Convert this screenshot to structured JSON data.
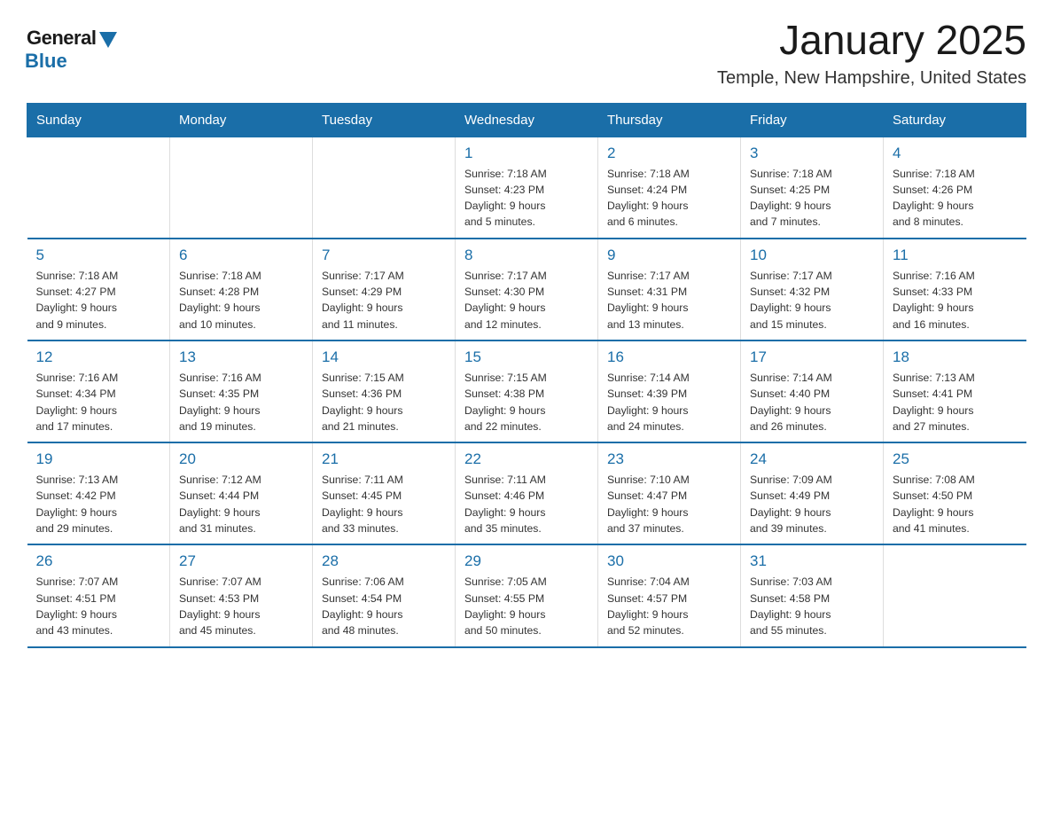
{
  "logo": {
    "text_general": "General",
    "text_blue": "Blue"
  },
  "title": "January 2025",
  "subtitle": "Temple, New Hampshire, United States",
  "days_of_week": [
    "Sunday",
    "Monday",
    "Tuesday",
    "Wednesday",
    "Thursday",
    "Friday",
    "Saturday"
  ],
  "weeks": [
    [
      {
        "day": null
      },
      {
        "day": null
      },
      {
        "day": null
      },
      {
        "day": "1",
        "sunrise": "7:18 AM",
        "sunset": "4:23 PM",
        "daylight": "9 hours and 5 minutes."
      },
      {
        "day": "2",
        "sunrise": "7:18 AM",
        "sunset": "4:24 PM",
        "daylight": "9 hours and 6 minutes."
      },
      {
        "day": "3",
        "sunrise": "7:18 AM",
        "sunset": "4:25 PM",
        "daylight": "9 hours and 7 minutes."
      },
      {
        "day": "4",
        "sunrise": "7:18 AM",
        "sunset": "4:26 PM",
        "daylight": "9 hours and 8 minutes."
      }
    ],
    [
      {
        "day": "5",
        "sunrise": "7:18 AM",
        "sunset": "4:27 PM",
        "daylight": "9 hours and 9 minutes."
      },
      {
        "day": "6",
        "sunrise": "7:18 AM",
        "sunset": "4:28 PM",
        "daylight": "9 hours and 10 minutes."
      },
      {
        "day": "7",
        "sunrise": "7:17 AM",
        "sunset": "4:29 PM",
        "daylight": "9 hours and 11 minutes."
      },
      {
        "day": "8",
        "sunrise": "7:17 AM",
        "sunset": "4:30 PM",
        "daylight": "9 hours and 12 minutes."
      },
      {
        "day": "9",
        "sunrise": "7:17 AM",
        "sunset": "4:31 PM",
        "daylight": "9 hours and 13 minutes."
      },
      {
        "day": "10",
        "sunrise": "7:17 AM",
        "sunset": "4:32 PM",
        "daylight": "9 hours and 15 minutes."
      },
      {
        "day": "11",
        "sunrise": "7:16 AM",
        "sunset": "4:33 PM",
        "daylight": "9 hours and 16 minutes."
      }
    ],
    [
      {
        "day": "12",
        "sunrise": "7:16 AM",
        "sunset": "4:34 PM",
        "daylight": "9 hours and 17 minutes."
      },
      {
        "day": "13",
        "sunrise": "7:16 AM",
        "sunset": "4:35 PM",
        "daylight": "9 hours and 19 minutes."
      },
      {
        "day": "14",
        "sunrise": "7:15 AM",
        "sunset": "4:36 PM",
        "daylight": "9 hours and 21 minutes."
      },
      {
        "day": "15",
        "sunrise": "7:15 AM",
        "sunset": "4:38 PM",
        "daylight": "9 hours and 22 minutes."
      },
      {
        "day": "16",
        "sunrise": "7:14 AM",
        "sunset": "4:39 PM",
        "daylight": "9 hours and 24 minutes."
      },
      {
        "day": "17",
        "sunrise": "7:14 AM",
        "sunset": "4:40 PM",
        "daylight": "9 hours and 26 minutes."
      },
      {
        "day": "18",
        "sunrise": "7:13 AM",
        "sunset": "4:41 PM",
        "daylight": "9 hours and 27 minutes."
      }
    ],
    [
      {
        "day": "19",
        "sunrise": "7:13 AM",
        "sunset": "4:42 PM",
        "daylight": "9 hours and 29 minutes."
      },
      {
        "day": "20",
        "sunrise": "7:12 AM",
        "sunset": "4:44 PM",
        "daylight": "9 hours and 31 minutes."
      },
      {
        "day": "21",
        "sunrise": "7:11 AM",
        "sunset": "4:45 PM",
        "daylight": "9 hours and 33 minutes."
      },
      {
        "day": "22",
        "sunrise": "7:11 AM",
        "sunset": "4:46 PM",
        "daylight": "9 hours and 35 minutes."
      },
      {
        "day": "23",
        "sunrise": "7:10 AM",
        "sunset": "4:47 PM",
        "daylight": "9 hours and 37 minutes."
      },
      {
        "day": "24",
        "sunrise": "7:09 AM",
        "sunset": "4:49 PM",
        "daylight": "9 hours and 39 minutes."
      },
      {
        "day": "25",
        "sunrise": "7:08 AM",
        "sunset": "4:50 PM",
        "daylight": "9 hours and 41 minutes."
      }
    ],
    [
      {
        "day": "26",
        "sunrise": "7:07 AM",
        "sunset": "4:51 PM",
        "daylight": "9 hours and 43 minutes."
      },
      {
        "day": "27",
        "sunrise": "7:07 AM",
        "sunset": "4:53 PM",
        "daylight": "9 hours and 45 minutes."
      },
      {
        "day": "28",
        "sunrise": "7:06 AM",
        "sunset": "4:54 PM",
        "daylight": "9 hours and 48 minutes."
      },
      {
        "day": "29",
        "sunrise": "7:05 AM",
        "sunset": "4:55 PM",
        "daylight": "9 hours and 50 minutes."
      },
      {
        "day": "30",
        "sunrise": "7:04 AM",
        "sunset": "4:57 PM",
        "daylight": "9 hours and 52 minutes."
      },
      {
        "day": "31",
        "sunrise": "7:03 AM",
        "sunset": "4:58 PM",
        "daylight": "9 hours and 55 minutes."
      },
      {
        "day": null
      }
    ]
  ],
  "labels": {
    "sunrise": "Sunrise:",
    "sunset": "Sunset:",
    "daylight": "Daylight:"
  }
}
